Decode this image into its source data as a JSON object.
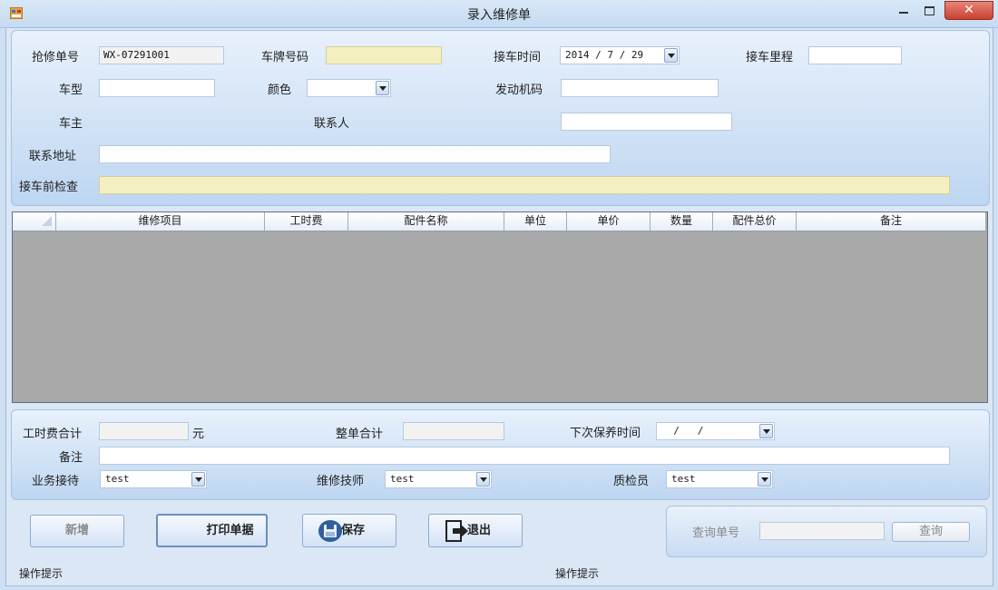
{
  "window": {
    "title": "录入维修单"
  },
  "header": {
    "order_no": {
      "label": "抢修单号",
      "value": "WX-07291001"
    },
    "plate_no": {
      "label": "车牌号码",
      "value": ""
    },
    "pickup_time": {
      "label": "接车时间",
      "value": "2014 / 7 / 29"
    },
    "mileage": {
      "label": "接车里程",
      "value": ""
    },
    "model": {
      "label": "车型",
      "value": ""
    },
    "color": {
      "label": "颜色",
      "value": ""
    },
    "engine_no": {
      "label": "发动机码",
      "value": ""
    },
    "owner": {
      "label": "车主"
    },
    "contact": {
      "label": "联系人",
      "value": ""
    },
    "address": {
      "label": "联系地址",
      "value": ""
    },
    "precheck": {
      "label": "接车前检查",
      "value": ""
    }
  },
  "grid": {
    "columns": [
      "",
      "维修项目",
      "工时费",
      "配件名称",
      "单位",
      "单价",
      "数量",
      "配件总价",
      "备注"
    ],
    "rows": []
  },
  "footer": {
    "labor_total": {
      "label": "工时费合计",
      "value": "",
      "unit": "元"
    },
    "order_total": {
      "label": "整单合计",
      "value": ""
    },
    "next_service": {
      "label": "下次保养时间",
      "value": "  /   /"
    },
    "remark": {
      "label": "备注",
      "value": ""
    },
    "receptionist": {
      "label": "业务接待",
      "value": "test"
    },
    "technician": {
      "label": "维修技师",
      "value": "test"
    },
    "inspector": {
      "label": "质检员",
      "value": "test"
    }
  },
  "actions": {
    "new": "新增",
    "print": "打印单据",
    "save": "保存",
    "exit": "退出"
  },
  "query": {
    "label": "查询单号",
    "value": "",
    "button": "查询"
  },
  "status": {
    "left": "操作提示",
    "right": "操作提示"
  },
  "icons": {
    "save": "floppy-disk-icon",
    "exit": "exit-arrow-icon",
    "app": "app-window-icon"
  }
}
